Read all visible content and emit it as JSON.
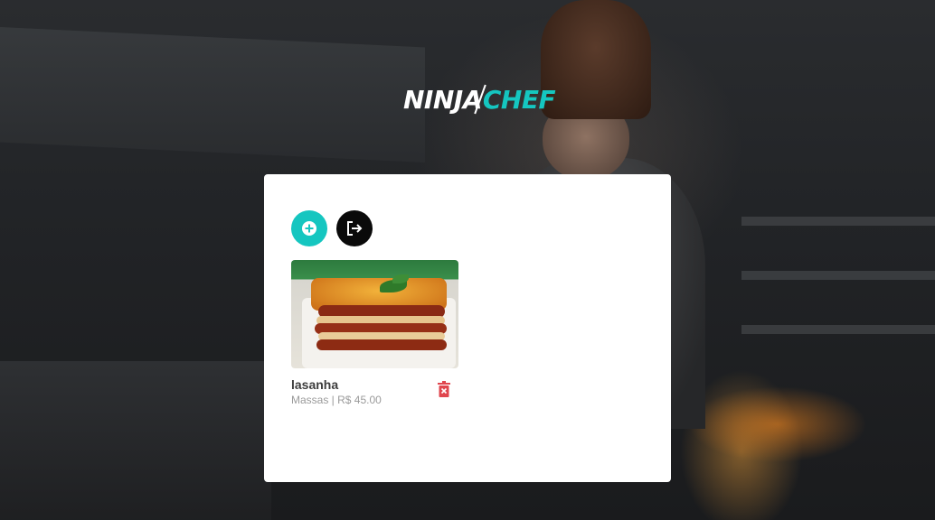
{
  "brand": {
    "logo_part1": "NINJA",
    "logo_part2": "CHEF",
    "accent_color": "#15c6c0"
  },
  "toolbar": {
    "add_icon": "plus-circle-icon",
    "logout_icon": "sign-out-icon"
  },
  "foods": [
    {
      "name": "lasanha",
      "category": "Massas",
      "separator": "|",
      "price": "R$ 45.00",
      "meta": "Massas | R$ 45.00",
      "delete_icon": "trash-icon",
      "delete_color": "#e0464e"
    }
  ]
}
